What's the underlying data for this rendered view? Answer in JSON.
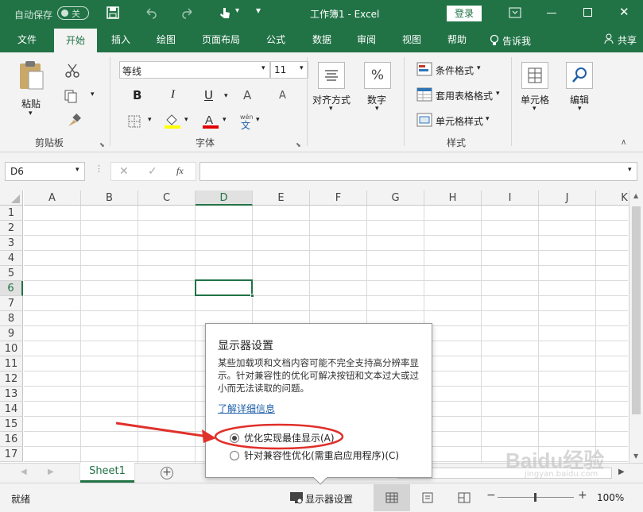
{
  "titlebar": {
    "autosave": "自动保存",
    "autosave_state": "关",
    "title": "工作簿1  -  Excel",
    "login": "登录"
  },
  "tabs": [
    "文件",
    "开始",
    "插入",
    "绘图",
    "页面布局",
    "公式",
    "数据",
    "审阅",
    "视图",
    "帮助"
  ],
  "tell_me": "告诉我",
  "share": "共享",
  "ribbon": {
    "clipboard": {
      "paste": "粘贴",
      "label": "剪贴板"
    },
    "font": {
      "name": "等线",
      "size": "11",
      "bold": "B",
      "italic": "I",
      "underline": "U",
      "grow": "A",
      "shrink": "A",
      "label": "字体"
    },
    "alignment": "对齐方式",
    "number": "数字",
    "styles": {
      "cond": "条件格式",
      "table": "套用表格格式",
      "cell": "单元格样式",
      "label": "样式"
    },
    "cells": "单元格",
    "editing": "编辑"
  },
  "formula_bar": {
    "name_box": "D6",
    "fx": "fx",
    "value": ""
  },
  "columns": [
    "A",
    "B",
    "C",
    "D",
    "E",
    "F",
    "G",
    "H",
    "I",
    "J",
    "K"
  ],
  "rows": [
    "1",
    "2",
    "3",
    "4",
    "5",
    "6",
    "7",
    "8",
    "9",
    "10",
    "11",
    "12",
    "13",
    "14",
    "15",
    "16",
    "17"
  ],
  "selected_cell": "D6",
  "sheet_tab": "Sheet1",
  "add_sheet": "+",
  "status": {
    "ready": "就绪",
    "display_settings": "显示器设置",
    "zoom": "100%"
  },
  "popup": {
    "title": "显示器设置",
    "body": "某些加载项和文档内容可能不完全支持高分辨率显示。针对兼容性的优化可解决按钮和文本过大或过小而无法读取的问题。",
    "link": "了解详细信息",
    "option1": "优化实现最佳显示(A)",
    "option2": "针对兼容性优化(需重启应用程序)(C)",
    "selected": "option1"
  },
  "watermark": {
    "text": "Baidu经验",
    "sub": "jingyan.baidu.com"
  },
  "colors": {
    "excel_green": "#217346",
    "annotation_red": "#e0302a"
  }
}
